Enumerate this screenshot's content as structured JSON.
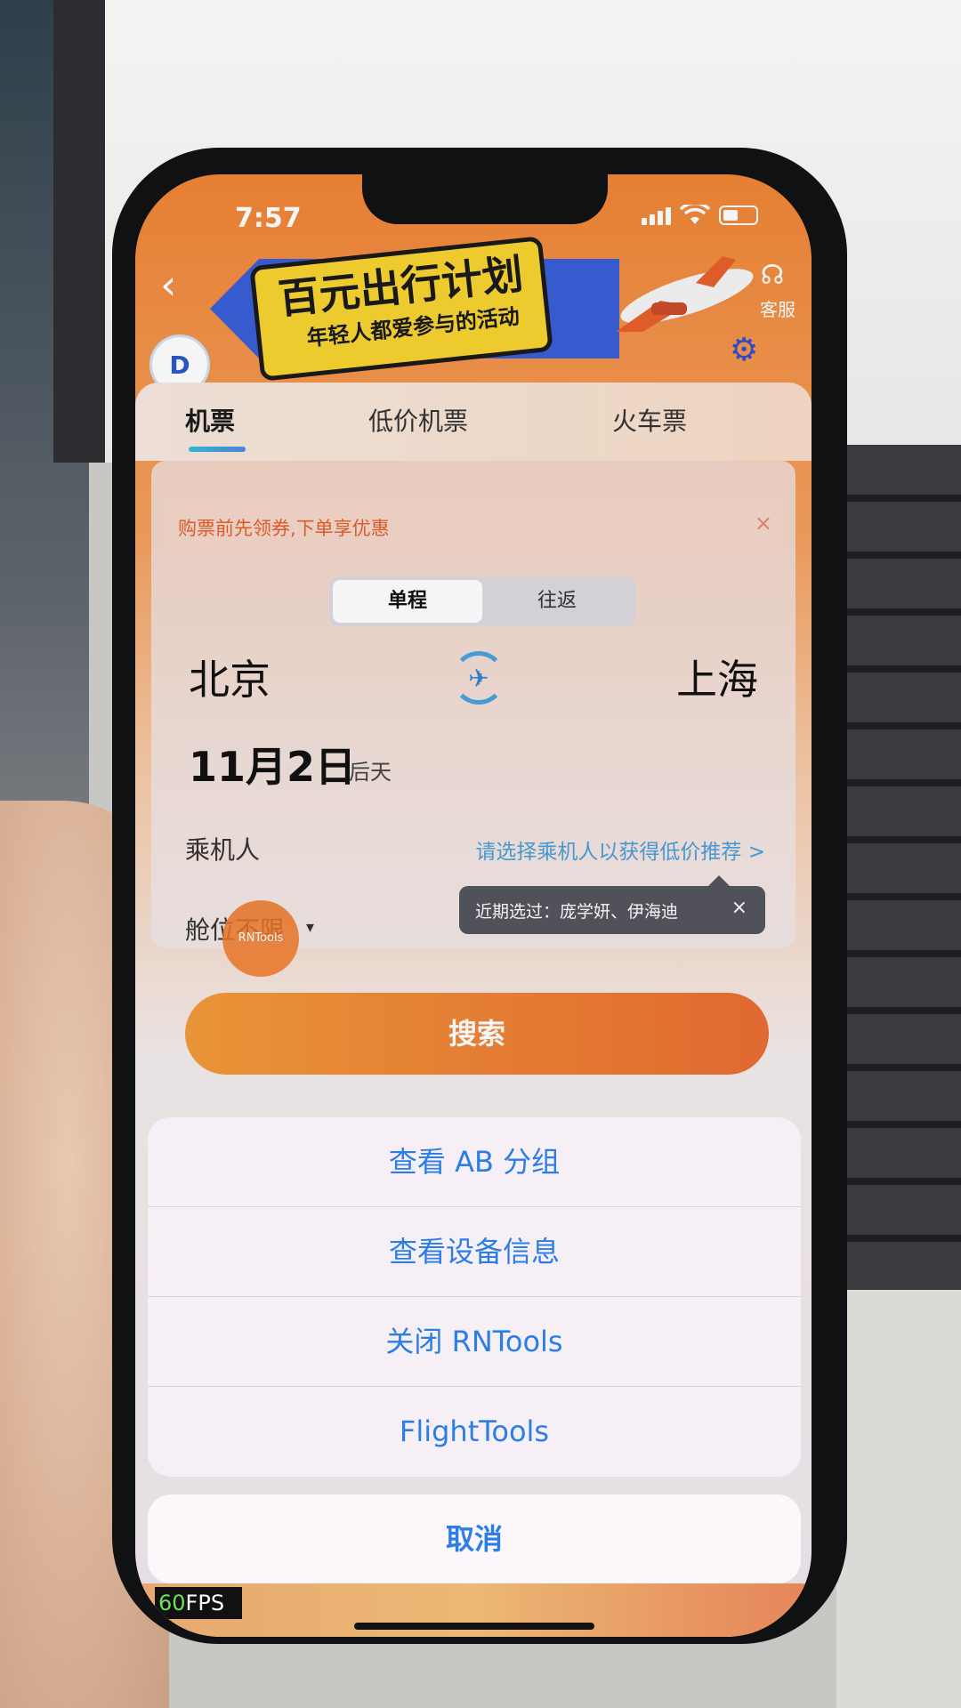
{
  "status": {
    "time": "7:57"
  },
  "header": {
    "banner_title": "百元出行计划",
    "banner_subtitle": "年轻人都爱参与的活动",
    "service_label": "客服"
  },
  "tabs": [
    {
      "label": "机票"
    },
    {
      "label": "低价机票"
    },
    {
      "label": "火车票"
    }
  ],
  "coupon": {
    "text": "购票前先领券,下单享优惠",
    "close": "×"
  },
  "trip_type": {
    "options": [
      "单程",
      "往返"
    ]
  },
  "route": {
    "from": "北京",
    "to": "上海"
  },
  "date": {
    "main": "11月2日",
    "sub": "后天"
  },
  "passenger": {
    "label": "乘机人",
    "hint": "请选择乘机人以获得低价推荐 >"
  },
  "cabin": {
    "label": "舱位不限",
    "caret": "▾"
  },
  "rntools_bubble": "RNTools",
  "tooltip": {
    "text": "近期选过：庞学妍、伊海迪",
    "close": "×"
  },
  "search": {
    "label": "搜索"
  },
  "action_sheet": {
    "items": [
      "查看 AB 分组",
      "查看设备信息",
      "关闭 RNTools",
      "FlightTools"
    ],
    "cancel": "取消"
  },
  "fps": {
    "value": "60",
    "unit": "FPS"
  },
  "colors": {
    "accent_orange": "#ea6e33",
    "link_blue": "#2a7ee6"
  }
}
